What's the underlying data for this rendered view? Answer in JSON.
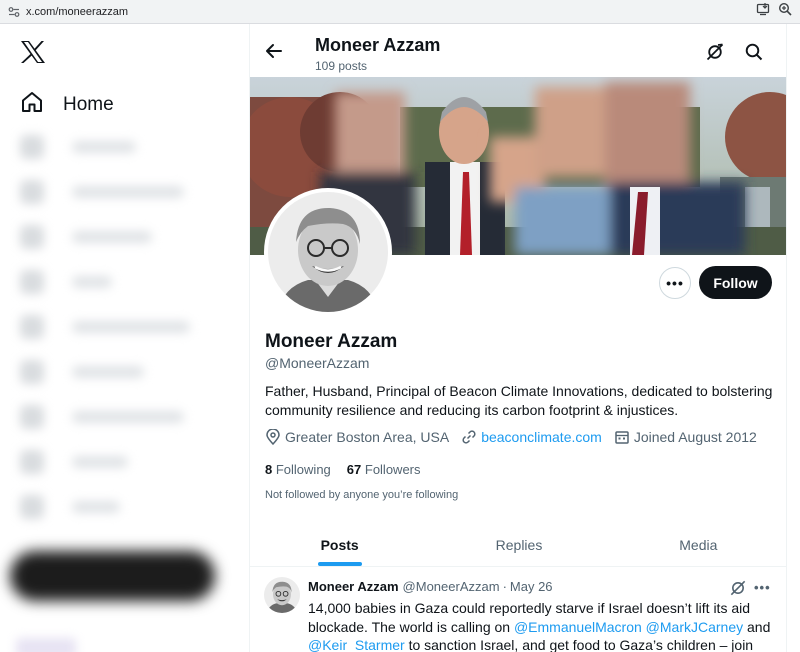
{
  "browser": {
    "url": "x.com/moneerazzam"
  },
  "sidebar": {
    "home_label": "Home"
  },
  "header": {
    "name": "Moneer Azzam",
    "post_count": "109 posts"
  },
  "profile": {
    "name": "Moneer Azzam",
    "handle": "@MoneerAzzam",
    "bio": "Father, Husband, Principal of Beacon Climate Innovations, dedicated to bolstering community resilience and  reducing its carbon footprint & injustices.",
    "location": "Greater Boston Area, USA",
    "website": "beaconclimate.com",
    "joined": "Joined August 2012",
    "following_count": "8",
    "following_label": "Following",
    "followers_count": "67",
    "followers_label": "Followers",
    "not_followed_text": "Not followed by anyone you’re following",
    "follow_button": "Follow",
    "more_button": "•••"
  },
  "tabs": [
    {
      "label": "Posts",
      "active": true
    },
    {
      "label": "Replies",
      "active": false
    },
    {
      "label": "Media",
      "active": false
    }
  ],
  "tweet": {
    "author_name": "Moneer Azzam",
    "author_handle": "@MoneerAzzam",
    "separator": "·",
    "date": "May 26",
    "more": "•••",
    "text_1": "14,000 babies in Gaza could reportedly starve if Israel doesn’t lift its aid blockade. The world is calling on ",
    "mention_1": "@EmmanuelMacron",
    "text_2": " ",
    "mention_2": "@MarkJCarney",
    "text_3": " and ",
    "mention_3": "@Keir_Starmer",
    "text_4": " to sanction Israel, and get food to Gaza’s children – join the"
  },
  "colors": {
    "accent": "#1d9bf0",
    "text": "#0f1419",
    "secondary_text": "#536471",
    "follow_button_bg": "#0f1419"
  },
  "icons": {
    "logo": "x-logo-icon",
    "home": "home-icon",
    "back": "back-arrow-icon",
    "grok": "grok-icon",
    "search": "search-icon",
    "location": "location-pin-icon",
    "link": "link-icon",
    "calendar": "calendar-icon"
  }
}
